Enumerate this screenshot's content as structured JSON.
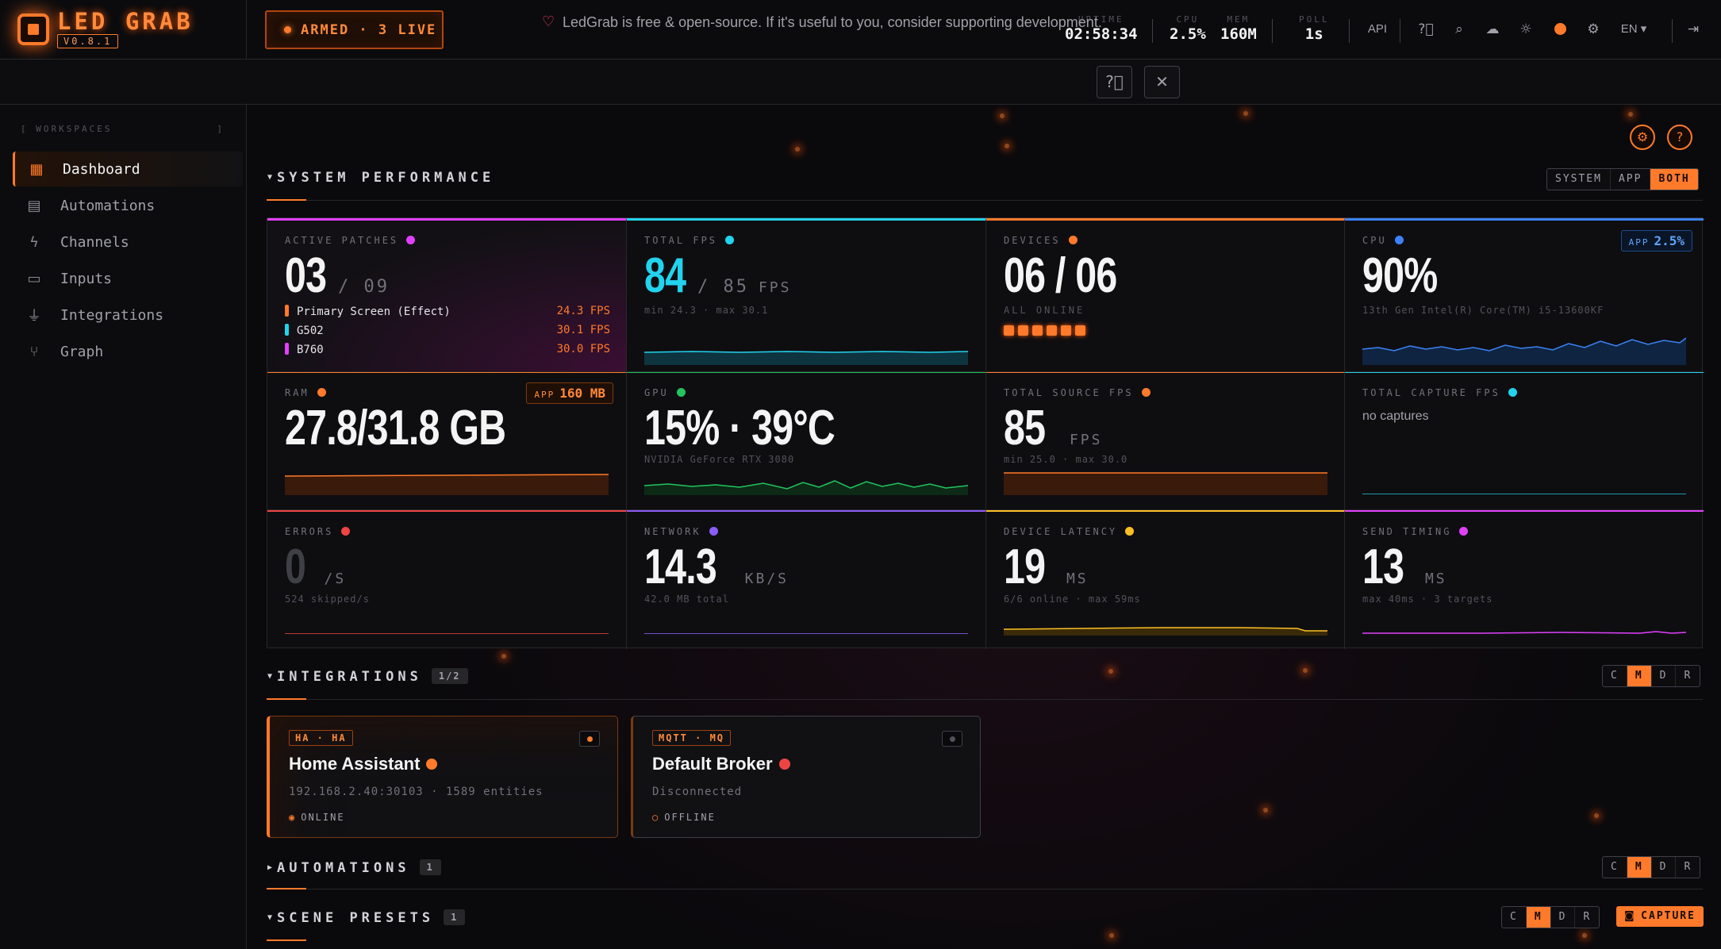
{
  "app": {
    "name": "LED GRAB",
    "version": "V0.8.1"
  },
  "header": {
    "armed": "ARMED · 3 LIVE",
    "stats": [
      {
        "label": "UPTIME",
        "value": "02:58:34"
      },
      {
        "label": "CPU",
        "value": "2.5%"
      },
      {
        "label": "MEM",
        "value": "160M"
      },
      {
        "label": "POLL",
        "value": "1s"
      }
    ],
    "api_label": "API",
    "lang": "EN"
  },
  "banner": {
    "text": "LedGrab is free & open-source. If it's useful to you, consider supporting development."
  },
  "sidebar": {
    "section": "WORKSPACES",
    "items": [
      {
        "label": "Dashboard",
        "icon": "dashboard-icon"
      },
      {
        "label": "Automations",
        "icon": "clipboard-icon"
      },
      {
        "label": "Channels",
        "icon": "lightning-icon"
      },
      {
        "label": "Inputs",
        "icon": "tv-icon"
      },
      {
        "label": "Integrations",
        "icon": "plug-icon"
      },
      {
        "label": "Graph",
        "icon": "graph-icon"
      }
    ]
  },
  "perf": {
    "title": "SYSTEM PERFORMANCE",
    "modes": [
      "SYSTEM",
      "APP",
      "BOTH"
    ],
    "active_mode": "BOTH",
    "active_patches": {
      "label": "ACTIVE PATCHES",
      "value": "03",
      "total": "/ 09",
      "rows": [
        {
          "name": "Primary Screen (Effect)",
          "fps": "24.3 FPS",
          "color": "#ff7a2a"
        },
        {
          "name": "G502",
          "fps": "30.1 FPS",
          "color": "#22d3ee"
        },
        {
          "name": "B760",
          "fps": "30.0 FPS",
          "color": "#e040fb"
        }
      ]
    },
    "total_fps": {
      "label": "TOTAL FPS",
      "value": "84",
      "total": "/ 85",
      "unit": "FPS",
      "sub": "min 24.3 · max 30.1"
    },
    "devices": {
      "label": "DEVICES",
      "value": "06 / 06",
      "sub": "ALL ONLINE",
      "count": 6
    },
    "cpu": {
      "label": "CPU",
      "value": "90%",
      "app_label": "APP",
      "app_value": "2.5%",
      "sub": "13th Gen Intel(R) Core(TM) i5-13600KF"
    },
    "ram": {
      "label": "RAM",
      "value": "27.8/31.8 GB",
      "app_label": "APP",
      "app_value": "160 MB"
    },
    "gpu": {
      "label": "GPU",
      "value": "15% · 39°C",
      "sub": "NVIDIA GeForce RTX 3080"
    },
    "source_fps": {
      "label": "TOTAL SOURCE FPS",
      "value": "85",
      "unit": "FPS",
      "sub": "min 25.0 · max 30.0"
    },
    "capture_fps": {
      "label": "TOTAL CAPTURE FPS",
      "empty": "no captures"
    },
    "errors": {
      "label": "ERRORS",
      "value": "0",
      "unit": "/S",
      "sub": "524 skipped/s"
    },
    "network": {
      "label": "NETWORK",
      "value": "14.3",
      "unit": "KB/S",
      "sub": "42.0 MB total"
    },
    "latency": {
      "label": "DEVICE LATENCY",
      "value": "19",
      "unit": "MS",
      "sub": "6/6 online · max 59ms"
    },
    "send_timing": {
      "label": "SEND TIMING",
      "value": "13",
      "unit": "MS",
      "sub": "max 40ms · 3 targets"
    }
  },
  "integrations": {
    "title": "INTEGRATIONS",
    "count": "1/2",
    "view_modes": [
      "C",
      "M",
      "D",
      "R"
    ],
    "active_view": "M",
    "cards": [
      {
        "tag": "HA · HA",
        "name": "Home Assistant",
        "address": "192.168.2.40:30103 · 1589 entities",
        "status": "ONLINE",
        "status_color": "#ff7a2a"
      },
      {
        "tag": "MQTT · MQ",
        "name": "Default Broker",
        "address": "Disconnected",
        "status": "OFFLINE",
        "status_color": "#ef4444"
      }
    ]
  },
  "automations": {
    "title": "AUTOMATIONS",
    "count": "1",
    "view_modes": [
      "C",
      "M",
      "D",
      "R"
    ]
  },
  "scene_presets": {
    "title": "SCENE PRESETS",
    "count": "1",
    "view_modes": [
      "C",
      "M",
      "D",
      "R"
    ],
    "capture_label": "CAPTURE"
  },
  "colors": {
    "accent": "#ff7a2a",
    "cyan": "#22d3ee",
    "magenta": "#e040fb",
    "blue": "#3b82f6",
    "green": "#22c55e",
    "red": "#ef4444",
    "violet": "#8b5cf6",
    "amber": "#fbbf24"
  }
}
